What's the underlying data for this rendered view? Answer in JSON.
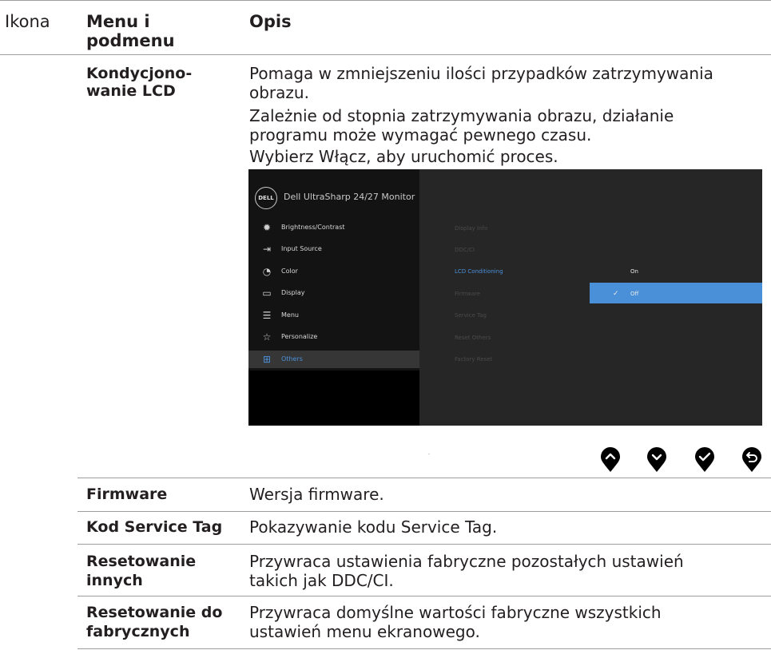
{
  "header": {
    "col_icon": "Ikona",
    "col_menu": "Menu i podmenu",
    "col_desc": "Opis"
  },
  "lcd": {
    "label": "Kondycjono-wanie LCD",
    "desc_lines": [
      "Pomaga w zmniejszeniu ilości przypadków zatrzymywania",
      "obrazu.",
      "Zależnie od stopnia zatrzymywania obrazu, działanie",
      "programu może wymagać pewnego czasu.",
      "Wybierz Włącz, aby uruchomić proces."
    ]
  },
  "osd": {
    "logo": "DELL",
    "title": "Dell UltraSharp 24/27 Monitor",
    "menu": [
      {
        "label": "Brightness/Contrast",
        "icon": "sun-icon"
      },
      {
        "label": "Input Source",
        "icon": "input-source-icon"
      },
      {
        "label": "Color",
        "icon": "palette-icon"
      },
      {
        "label": "Display",
        "icon": "display-icon"
      },
      {
        "label": "Menu",
        "icon": "menu-icon"
      },
      {
        "label": "Personalize",
        "icon": "star-icon"
      },
      {
        "label": "Others",
        "icon": "others-icon"
      }
    ],
    "submenu": [
      "Display Info",
      "DDC/CI",
      "LCD Conditioning",
      "Firmware",
      "Service Tag",
      "Reset Others",
      "Factory Reset"
    ],
    "options": [
      "On",
      "Off"
    ],
    "selected_option": "Off",
    "colors": {
      "accent": "#4a90d9",
      "panel_left": "#131313",
      "panel_right": "#262626"
    }
  },
  "buttons": [
    {
      "icon": "up-arrow-icon"
    },
    {
      "icon": "down-arrow-icon"
    },
    {
      "icon": "check-icon"
    },
    {
      "icon": "back-icon"
    }
  ],
  "rows": [
    {
      "label": "Firmware",
      "desc": "Wersja firmware."
    },
    {
      "label": "Kod Service Tag",
      "desc": "Pokazywanie kodu Service Tag."
    },
    {
      "label_lines": [
        "Resetowanie",
        "innych"
      ],
      "desc_lines": [
        "Przywraca ustawienia fabryczne pozostałych ustawień",
        "takich jak DDC/CI."
      ]
    },
    {
      "label_lines": [
        "Resetowanie do",
        "fabrycznych"
      ],
      "desc_lines": [
        "Przywraca domyślne wartości fabryczne wszystkich",
        "ustawień menu ekranowego."
      ]
    }
  ]
}
